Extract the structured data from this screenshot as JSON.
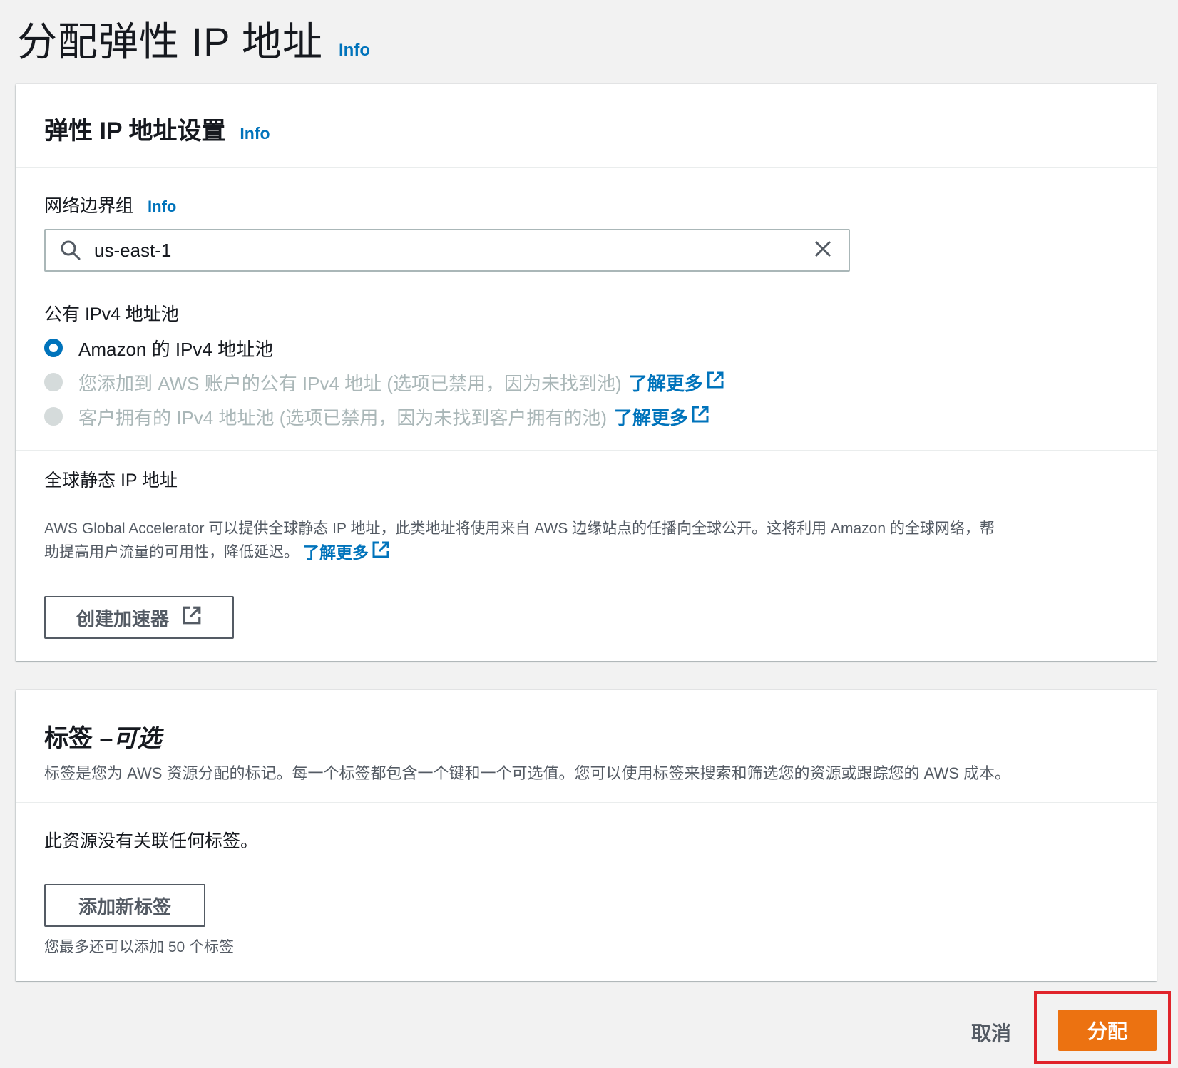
{
  "header": {
    "title": "分配弹性 IP 地址",
    "info": "Info"
  },
  "settings": {
    "title": "弹性 IP 地址设置",
    "info": "Info",
    "network_border_group": {
      "label": "网络边界组",
      "info": "Info",
      "value": "us-east-1"
    },
    "ipv4_pool": {
      "label": "公有 IPv4 地址池",
      "options": [
        {
          "label": "Amazon 的 IPv4 地址池",
          "selected": true,
          "disabled": false,
          "link": ""
        },
        {
          "label": "您添加到 AWS 账户的公有 IPv4 地址 (选项已禁用，因为未找到池)",
          "selected": false,
          "disabled": true,
          "link": "了解更多"
        },
        {
          "label": "客户拥有的 IPv4 地址池 (选项已禁用，因为未找到客户拥有的池)",
          "selected": false,
          "disabled": true,
          "link": "了解更多"
        }
      ]
    },
    "global_static": {
      "label": "全球静态 IP 地址",
      "description_line1": "AWS Global Accelerator 可以提供全球静态 IP 地址，此类地址将使用来自 AWS 边缘站点的任播向全球公开。这将利用 Amazon 的全球网络，帮",
      "description_line2": "助提高用户流量的可用性，降低延迟。",
      "learn_more": "了解更多",
      "button": "创建加速器"
    }
  },
  "tags": {
    "title": "标签 – ",
    "title_optional": "可选",
    "description": "标签是您为 AWS 资源分配的标记。每一个标签都包含一个键和一个可选值。您可以使用标签来搜索和筛选您的资源或跟踪您的 AWS 成本。",
    "empty": "此资源没有关联任何标签。",
    "add_button": "添加新标签",
    "hint": "您最多还可以添加 50 个标签"
  },
  "footer": {
    "cancel": "取消",
    "submit": "分配"
  },
  "icons": {
    "search": "search-icon",
    "clear": "close-icon",
    "external": "external-link-icon"
  },
  "colors": {
    "link": "#0073bb",
    "primary": "#ec7211",
    "highlight": "#e0242b"
  }
}
